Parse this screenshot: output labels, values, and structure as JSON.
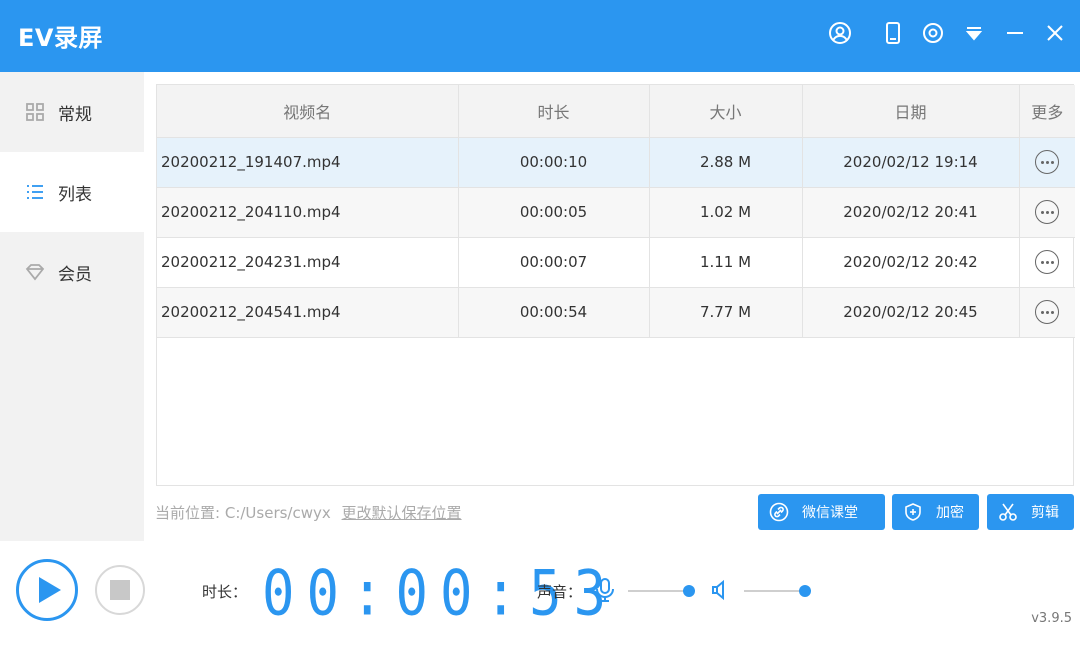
{
  "app": {
    "title": "EV录屏",
    "version": "v3.9.5"
  },
  "titlebar_icons": [
    "user-icon",
    "phone-icon",
    "settings-icon",
    "dropdown-icon",
    "minimize-icon",
    "close-icon"
  ],
  "sidebar": {
    "items": [
      {
        "label": "常规",
        "icon": "grid-icon",
        "active": false
      },
      {
        "label": "列表",
        "icon": "list-icon",
        "active": true
      },
      {
        "label": "会员",
        "icon": "diamond-icon",
        "active": false
      }
    ]
  },
  "table": {
    "columns": [
      "视频名",
      "时长",
      "大小",
      "日期",
      "更多"
    ],
    "rows": [
      {
        "name": "20200212_191407.mp4",
        "duration": "00:00:10",
        "size": "2.88 M",
        "date": "2020/02/12 19:14"
      },
      {
        "name": "20200212_204110.mp4",
        "duration": "00:00:05",
        "size": "1.02 M",
        "date": "2020/02/12 20:41"
      },
      {
        "name": "20200212_204231.mp4",
        "duration": "00:00:07",
        "size": "1.11 M",
        "date": "2020/02/12 20:42"
      },
      {
        "name": "20200212_204541.mp4",
        "duration": "00:00:54",
        "size": "7.77 M",
        "date": "2020/02/12 20:45"
      }
    ]
  },
  "path": {
    "label": "当前位置:",
    "value": "C:/Users/cwyx",
    "change_link": "更改默认保存位置"
  },
  "actions": {
    "wechat": "微信课堂",
    "encrypt": "加密",
    "edit": "剪辑"
  },
  "recorder": {
    "duration_label": "时长：",
    "timer": "00:00:53",
    "sound_label": "声音："
  },
  "colors": {
    "accent": "#2b96f0",
    "selected_row": "#e6f2fb",
    "sidebar_bg": "#f2f2f2"
  }
}
